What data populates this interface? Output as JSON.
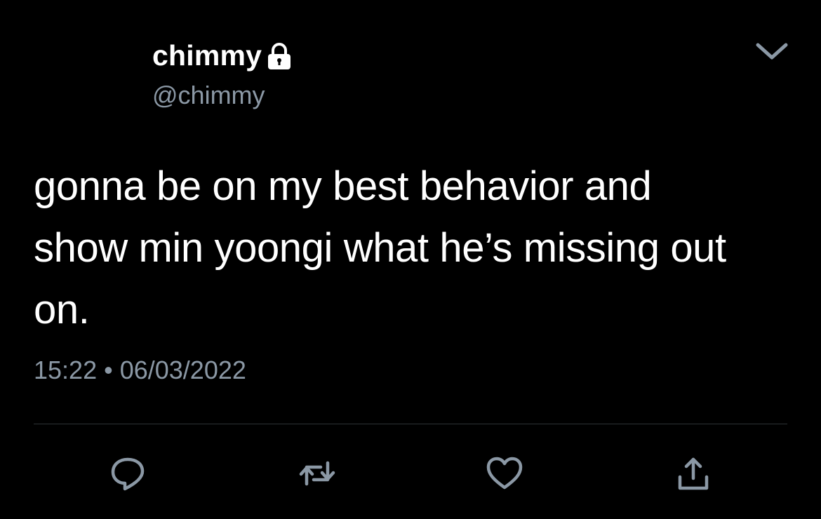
{
  "tweet": {
    "display_name": "chimmy",
    "handle": "@chimmy",
    "text": "gonna be on my best behavior and show min yoongi what he’s missing out on.",
    "time": "15:22",
    "separator": "•",
    "date": "06/03/2022",
    "protected": true
  },
  "icons": {
    "lock": "lock-icon",
    "menu": "chevron-down-icon",
    "reply": "reply-icon",
    "retweet": "retweet-icon",
    "like": "heart-icon",
    "share": "share-icon"
  },
  "colors": {
    "background": "#000000",
    "text": "#ffffff",
    "secondary": "#8b98a5",
    "divider": "#2f3336"
  }
}
